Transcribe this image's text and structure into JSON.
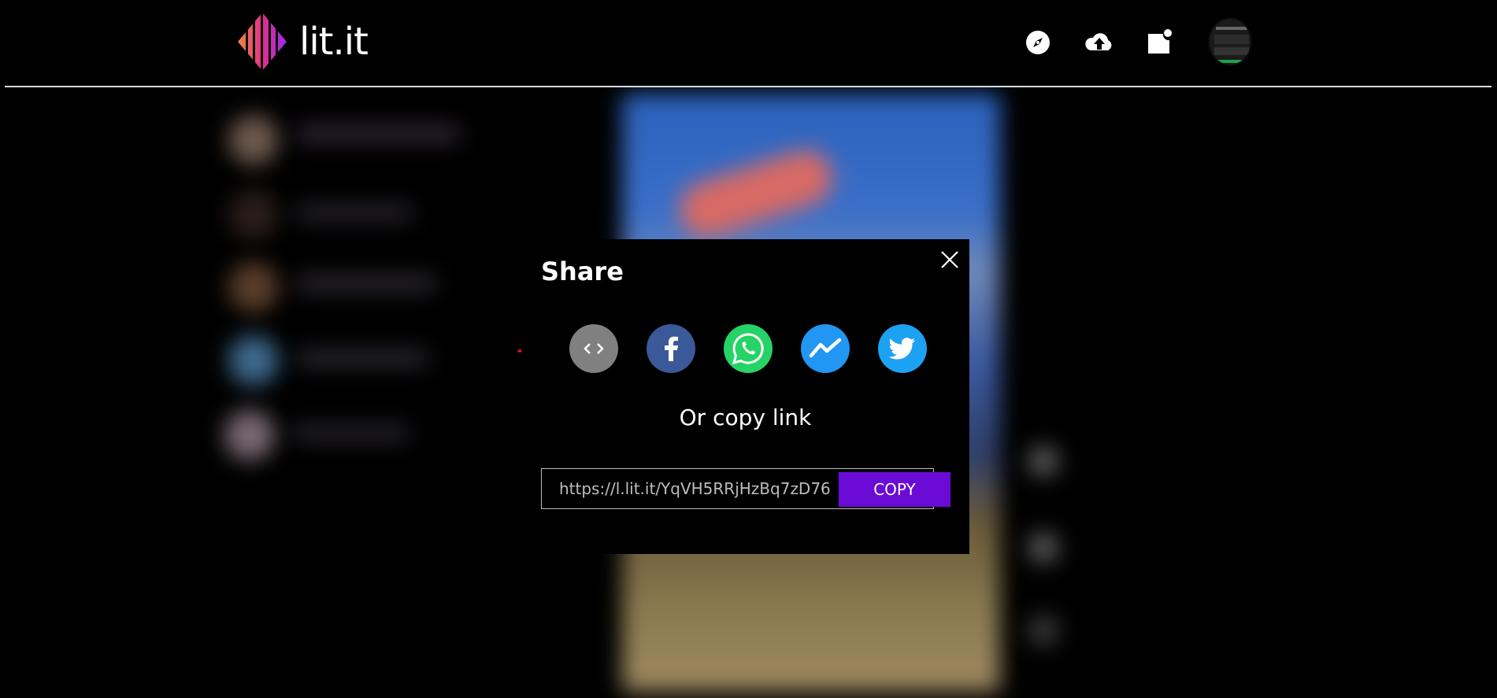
{
  "header": {
    "brand_name": "lit.it",
    "icons": [
      "compass-icon",
      "upload-cloud-icon",
      "notification-icon"
    ]
  },
  "modal": {
    "title": "Share",
    "close_icon": "close-icon",
    "share_options": [
      {
        "name": "embed",
        "icon": "embed-code-icon",
        "color": "#808080"
      },
      {
        "name": "facebook",
        "icon": "facebook-icon",
        "color": "#3b5998"
      },
      {
        "name": "whatsapp",
        "icon": "whatsapp-icon",
        "color": "#25d366"
      },
      {
        "name": "messenger",
        "icon": "messenger-icon",
        "color": "#2196f3"
      },
      {
        "name": "twitter",
        "icon": "twitter-icon",
        "color": "#1da1f2"
      }
    ],
    "copy_label": "Or copy link",
    "link_value": "https://l.lit.it/YqVH5RRjHzBq7zD76",
    "copy_button": "COPY"
  },
  "colors": {
    "accent": "#6a0bd6",
    "annotation": "#e01515"
  }
}
